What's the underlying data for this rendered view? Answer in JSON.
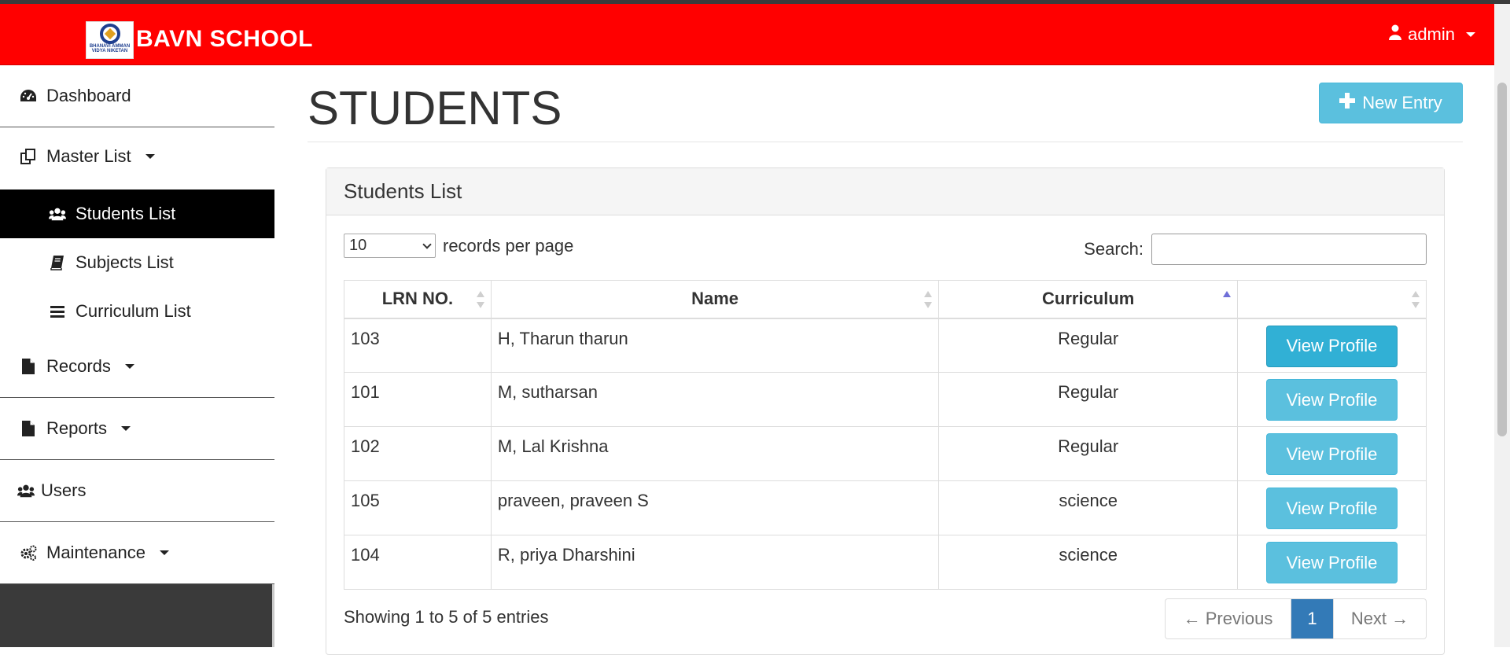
{
  "header": {
    "brand": "BAVN SCHOOL",
    "logo_text": [
      "BHANAVI AMMAN",
      "VIDYA NIKETAN"
    ],
    "user_label": "admin"
  },
  "sidebar": {
    "items": [
      {
        "label": "Dashboard",
        "icon": "dashboard-icon"
      },
      {
        "label": "Master List",
        "icon": "copy-icon"
      },
      {
        "label": "Records",
        "icon": "file-icon"
      },
      {
        "label": "Reports",
        "icon": "file-icon"
      },
      {
        "label": "Users",
        "icon": "users-icon"
      },
      {
        "label": "Maintenance",
        "icon": "cogs-icon"
      }
    ],
    "submenu": [
      {
        "label": "Students List",
        "icon": "users-icon",
        "active": true
      },
      {
        "label": "Subjects List",
        "icon": "book-icon",
        "active": false
      },
      {
        "label": "Curriculum List",
        "icon": "list-icon",
        "active": false
      }
    ]
  },
  "page": {
    "title": "STUDENTS",
    "new_entry_label": "New Entry"
  },
  "panel": {
    "heading": "Students List",
    "per_page_value": "10",
    "per_page_label": "records per page",
    "search_label": "Search:",
    "search_value": "",
    "columns": [
      "LRN NO.",
      "Name",
      "Curriculum",
      ""
    ],
    "rows": [
      {
        "lrn": "103",
        "name": "H, Tharun tharun",
        "curriculum": "Regular",
        "action": "View Profile"
      },
      {
        "lrn": "101",
        "name": "M, sutharsan",
        "curriculum": "Regular",
        "action": "View Profile"
      },
      {
        "lrn": "102",
        "name": "M, Lal Krishna",
        "curriculum": "Regular",
        "action": "View Profile"
      },
      {
        "lrn": "105",
        "name": "praveen, praveen S",
        "curriculum": "science",
        "action": "View Profile"
      },
      {
        "lrn": "104",
        "name": "R, priya Dharshini",
        "curriculum": "science",
        "action": "View Profile"
      }
    ],
    "info": "Showing 1 to 5 of 5 entries",
    "pager": {
      "prev": "← Previous",
      "current": "1",
      "next": "Next →"
    }
  },
  "colors": {
    "navbar": "#ff0000",
    "info_button": "#5bc0de",
    "active_page": "#337ab7",
    "active_sidebar": "#000000"
  }
}
